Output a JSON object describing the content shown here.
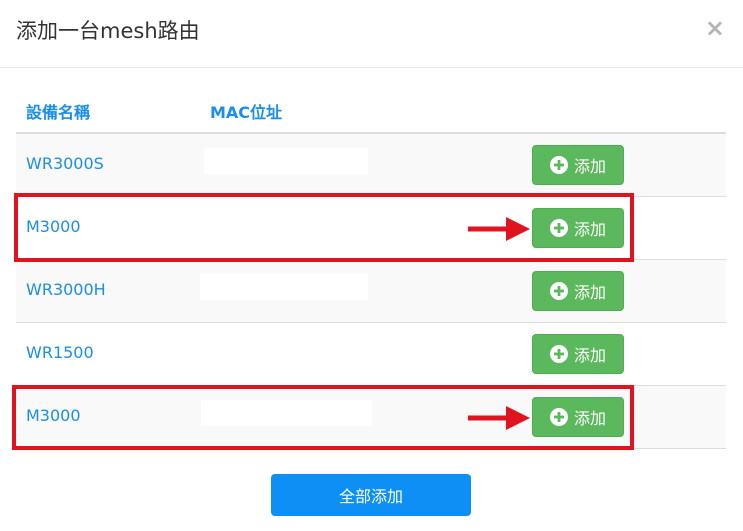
{
  "dialog": {
    "title": "添加一台mesh路由",
    "close_label": "×"
  },
  "table": {
    "columns": [
      "設備名稱",
      "MAC位址"
    ],
    "rows": [
      {
        "name": "WR3000S",
        "mac": "",
        "action": "添加"
      },
      {
        "name": "M3000",
        "mac": "",
        "action": "添加"
      },
      {
        "name": "WR3000H",
        "mac": "",
        "action": "添加"
      },
      {
        "name": "WR1500",
        "mac": "",
        "action": "添加"
      },
      {
        "name": "M3000",
        "mac": "",
        "action": "添加"
      }
    ]
  },
  "footer": {
    "add_all_label": "全部添加"
  },
  "colors": {
    "accent_blue": "#1a8ee8",
    "button_green": "#5cb85c",
    "primary_blue": "#0d8ff5",
    "highlight_red": "#e0141e"
  },
  "icons": [
    "close-icon",
    "plus-circle-icon",
    "arrow-right-icon"
  ]
}
